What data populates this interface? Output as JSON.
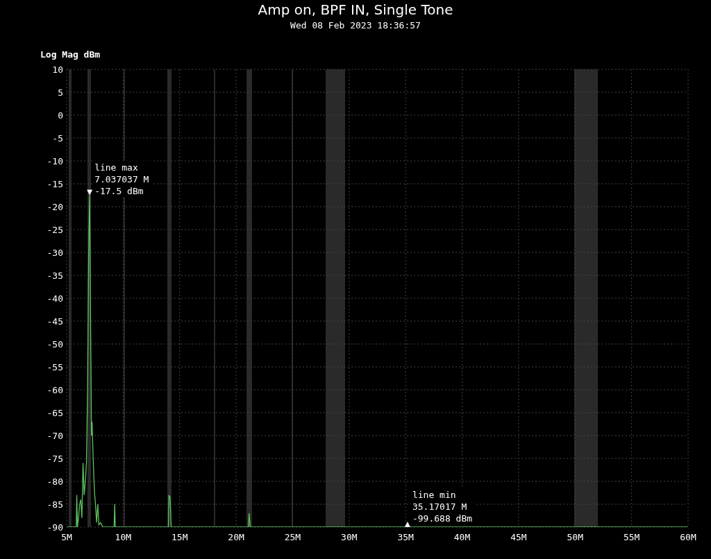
{
  "timestamp": "Wed 08 Feb 2023 18:36:57",
  "chart_data": {
    "type": "line",
    "title": "Amp on, BPF IN, Single Tone",
    "ylabel": "Log Mag dBm",
    "xlim": [
      5,
      60
    ],
    "ylim": [
      -90,
      10
    ],
    "xticks": [
      {
        "value": 5,
        "label": "5M"
      },
      {
        "value": 10,
        "label": "10M"
      },
      {
        "value": 15,
        "label": "15M"
      },
      {
        "value": 20,
        "label": "20M"
      },
      {
        "value": 25,
        "label": "25M"
      },
      {
        "value": 30,
        "label": "30M"
      },
      {
        "value": 35,
        "label": "35M"
      },
      {
        "value": 40,
        "label": "40M"
      },
      {
        "value": 45,
        "label": "45M"
      },
      {
        "value": 50,
        "label": "50M"
      },
      {
        "value": 55,
        "label": "55M"
      },
      {
        "value": 60,
        "label": "60M"
      }
    ],
    "yticks": [
      10,
      5,
      0,
      -5,
      -10,
      -15,
      -20,
      -25,
      -30,
      -35,
      -40,
      -45,
      -50,
      -55,
      -60,
      -65,
      -70,
      -75,
      -80,
      -85,
      -90
    ],
    "series": [
      {
        "color": "#5ec45e",
        "x": [
          5,
          5.85,
          5.9,
          5.95,
          6.05,
          6.15,
          6.25,
          6.35,
          6.45,
          6.55,
          6.65,
          6.75,
          6.85,
          6.95,
          7.037037,
          7.1,
          7.2,
          7.25,
          7.35,
          7.45,
          7.55,
          7.65,
          7.75,
          7.85,
          8.0,
          8.2,
          9.2,
          9.25,
          9.3,
          14.0,
          14.05,
          14.15,
          14.25,
          21.1,
          21.15,
          21.25,
          60
        ],
        "values": [
          -90,
          -90,
          -83,
          -90,
          -88,
          -85,
          -84,
          -88,
          -76,
          -83,
          -80,
          -76,
          -60,
          -30,
          -17.5,
          -40,
          -70,
          -67,
          -75,
          -82,
          -85,
          -89,
          -85,
          -89.5,
          -89,
          -90,
          -90,
          -85,
          -90,
          -90,
          -83,
          -83.5,
          -90,
          -90,
          -87,
          -90,
          -90
        ]
      }
    ],
    "grid": true,
    "annotations": [
      {
        "x": 7.037037,
        "y": -17.5,
        "text": "line max\n7.037037 M\n-17.5 dBm"
      },
      {
        "x": 35.17017,
        "y": -90,
        "text": "line min\n35.17017 M\n-99.688 dBm"
      }
    ]
  }
}
